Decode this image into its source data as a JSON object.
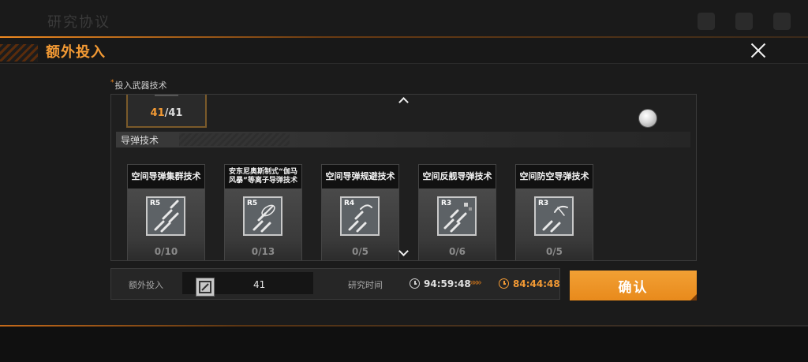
{
  "background": {
    "screen_title_ghost": "研究协议"
  },
  "modal": {
    "title": "额外投入",
    "section_label": "投入武器技术",
    "required_mark": "*"
  },
  "previous_card": {
    "current": "41",
    "separator": "/",
    "total": "41"
  },
  "category": {
    "title": "导弹技术"
  },
  "cards": [
    {
      "title": "空间导弹集群技术",
      "rank": "R5",
      "progress": "0/10"
    },
    {
      "title": "安东尼奥斯制式“伽马风暴”等离子导弹技术",
      "rank": "R5",
      "progress": "0/13"
    },
    {
      "title": "空间导弹规避技术",
      "rank": "R4",
      "progress": "0/5"
    },
    {
      "title": "空间反舰导弹技术",
      "rank": "R3",
      "progress": "0/6"
    },
    {
      "title": "空间防空导弹技术",
      "rank": "R3",
      "progress": "0/5"
    }
  ],
  "bottom": {
    "extra_label": "额外投入",
    "extra_amount": "41",
    "time_label": "研究时间",
    "time_base": "94:59:48",
    "time_new": "84:44:48",
    "arrows": "»»»"
  },
  "confirm_label": "确认",
  "colors": {
    "accent": "#f39a34",
    "panel": "#1f1f1f",
    "card": "#2b2b2b"
  }
}
